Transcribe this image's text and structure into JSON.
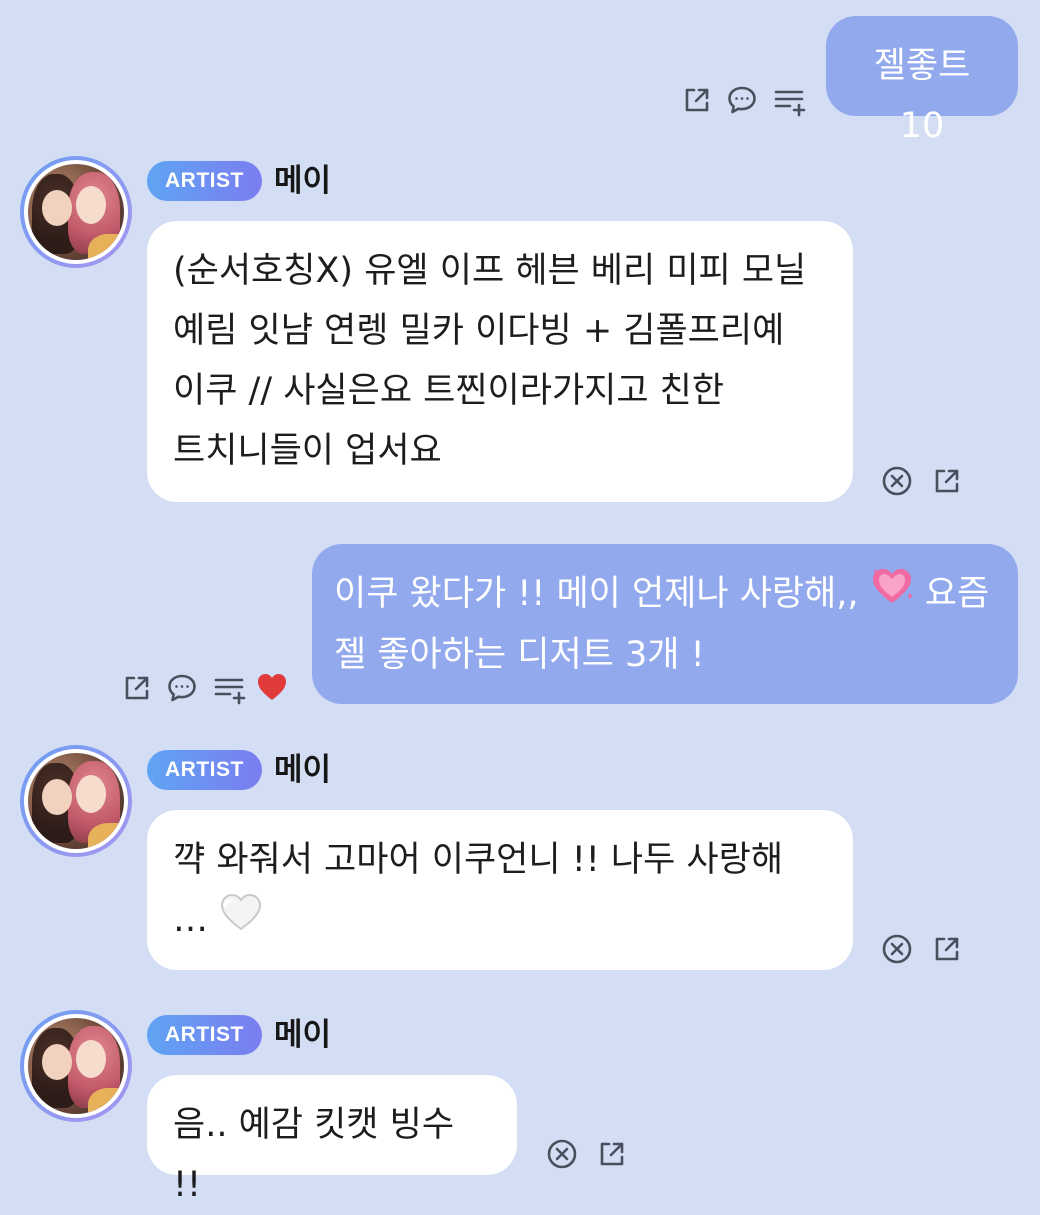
{
  "colors": {
    "background": "#d3def4",
    "my_bubble": "#93a9ee",
    "artist_bubble": "#ffffff",
    "badge_gradient_start": "#5fa4f4",
    "badge_gradient_end": "#7b7df0",
    "liked_heart": "#e03a3a"
  },
  "messages": [
    {
      "type": "mine",
      "text": "젤좋트 10",
      "actions": [
        "share-icon",
        "comment-icon",
        "add-to-list-icon"
      ]
    },
    {
      "type": "artist",
      "badge": "ARTIST",
      "sender": "메이",
      "text": "(순서호칭X) 유엘 이프 헤븐 베리 미피 모닐 예림 잇냠 연렝 밀카 이다빙 + 김폴프리예 이쿠 // 사실은요 트찐이라가지고 친한 트치니들이 업서요",
      "actions": [
        "close-circle-icon",
        "share-icon"
      ]
    },
    {
      "type": "mine",
      "text_before_emoji": "이쿠 왔다가 !! 메이 언제나 사랑해,, ",
      "text_after_emoji": " 요즘 젤 좋아하는 디저트 3개 !",
      "emoji": "sparkling-heart-emoji",
      "liked": true,
      "actions": [
        "share-icon",
        "comment-icon",
        "add-to-list-icon",
        "heart-icon"
      ]
    },
    {
      "type": "artist",
      "badge": "ARTIST",
      "sender": "메이",
      "text_before_emoji": "꺅 와줘서 고마어 이쿠언니 !! 나두 사랑해 … ",
      "emoji": "white-heart-emoji",
      "actions": [
        "close-circle-icon",
        "share-icon"
      ]
    },
    {
      "type": "artist",
      "badge": "ARTIST",
      "sender": "메이",
      "text": "음.. 예감 킷캣 빙수 !!",
      "actions": [
        "close-circle-icon",
        "share-icon"
      ]
    }
  ]
}
